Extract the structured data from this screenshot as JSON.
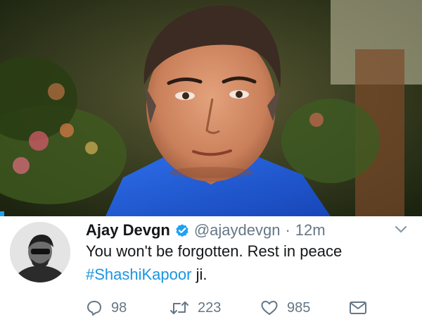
{
  "colors": {
    "link": "#1b95e0",
    "verified": "#1da1f2",
    "muted": "#657786",
    "text": "#14171a",
    "shirt": "#1f5bd6"
  },
  "photo": {
    "subject": "portrait of actor in blue shirt"
  },
  "tweet": {
    "author": {
      "display_name": "Ajay Devgn",
      "handle": "@ajaydevgn",
      "verified_icon": "verified-badge-icon"
    },
    "separator": "·",
    "timestamp": "12m",
    "text": {
      "line1": "You won't be forgotten. Rest in peace",
      "hashtag": "#ShashiKapoor",
      "tail": " ji."
    },
    "actions": {
      "reply": {
        "icon": "reply-icon",
        "count": "98"
      },
      "retweet": {
        "icon": "retweet-icon",
        "count": "223"
      },
      "like": {
        "icon": "heart-icon",
        "count": "985"
      },
      "message": {
        "icon": "envelope-icon"
      }
    },
    "more_icon": "chevron-down-icon"
  }
}
